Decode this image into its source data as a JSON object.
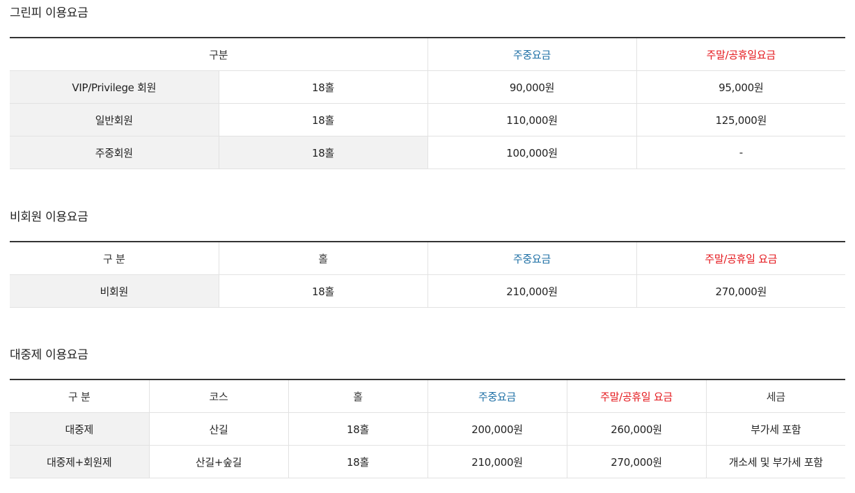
{
  "sections": [
    {
      "title": "그린피 이용요금",
      "headers": [
        "구분",
        "주중요금",
        "주말/공휴일요금"
      ],
      "rows": [
        [
          "VIP/Privilege 회원",
          "18홀",
          "90,000원",
          "95,000원"
        ],
        [
          "일반회원",
          "18홀",
          "110,000원",
          "125,000원"
        ],
        [
          "주중회원",
          "18홀",
          "100,000원",
          "-"
        ]
      ]
    },
    {
      "title": "비회원 이용요금",
      "headers": [
        "구 분",
        "홀",
        "주중요금",
        "주말/공휴일 요금"
      ],
      "rows": [
        [
          "비회원",
          "18홀",
          "210,000원",
          "270,000원"
        ]
      ]
    },
    {
      "title": "대중제 이용요금",
      "headers": [
        "구 분",
        "코스",
        "홀",
        "주중요금",
        "주말/공휴일 요금",
        "세금"
      ],
      "rows": [
        [
          "대중제",
          "산길",
          "18홀",
          "200,000원",
          "260,000원",
          "부가세 포함"
        ],
        [
          "대중제+회원제",
          "산길+숲길",
          "18홀",
          "210,000원",
          "270,000원",
          "개소세 및 부가세 포함"
        ]
      ]
    }
  ],
  "colors": {
    "weekday_header": "#1d6fa5",
    "weekend_header": "#e4161b",
    "category_cell_bg": "#f2f2f2",
    "table_top_border": "#333333"
  }
}
